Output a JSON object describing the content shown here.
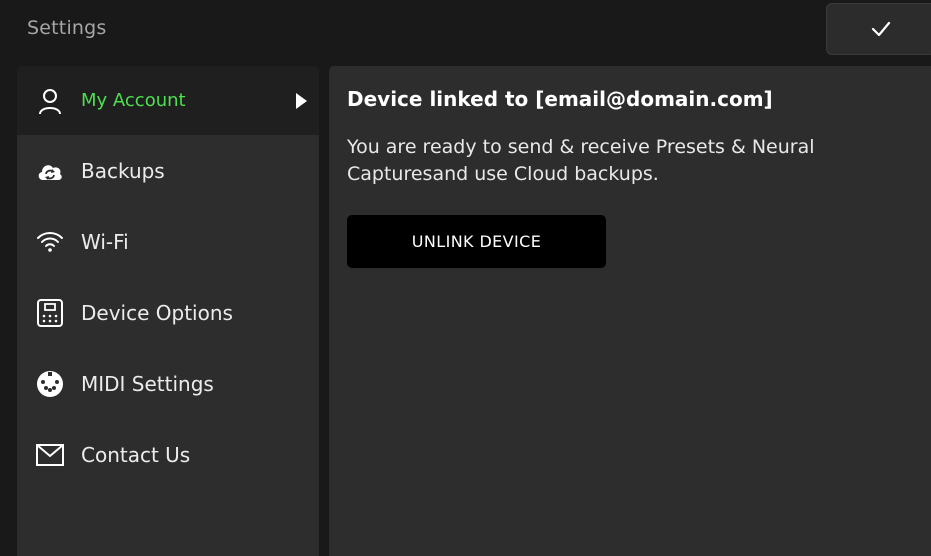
{
  "header": {
    "title": "Settings",
    "confirm_icon": "check-icon"
  },
  "sidebar": {
    "items": [
      {
        "label": "My Account",
        "icon": "user-icon",
        "active": true
      },
      {
        "label": "Backups",
        "icon": "cloud-sync-icon"
      },
      {
        "label": "Wi-Fi",
        "icon": "wifi-icon"
      },
      {
        "label": "Device Options",
        "icon": "device-icon"
      },
      {
        "label": "MIDI Settings",
        "icon": "midi-icon"
      },
      {
        "label": "Contact Us",
        "icon": "mail-icon"
      }
    ]
  },
  "account": {
    "title": "Device linked to [email@domain.com]",
    "description": "You are ready to send & receive Presets & Neural Capturesand use Cloud backups.",
    "unlink_label": "UNLINK DEVICE"
  },
  "colors": {
    "background": "#191919",
    "panel": "#2d2d2d",
    "active_item": "#1f1f1f",
    "accent": "#4ddf4f",
    "button": "#000000"
  }
}
